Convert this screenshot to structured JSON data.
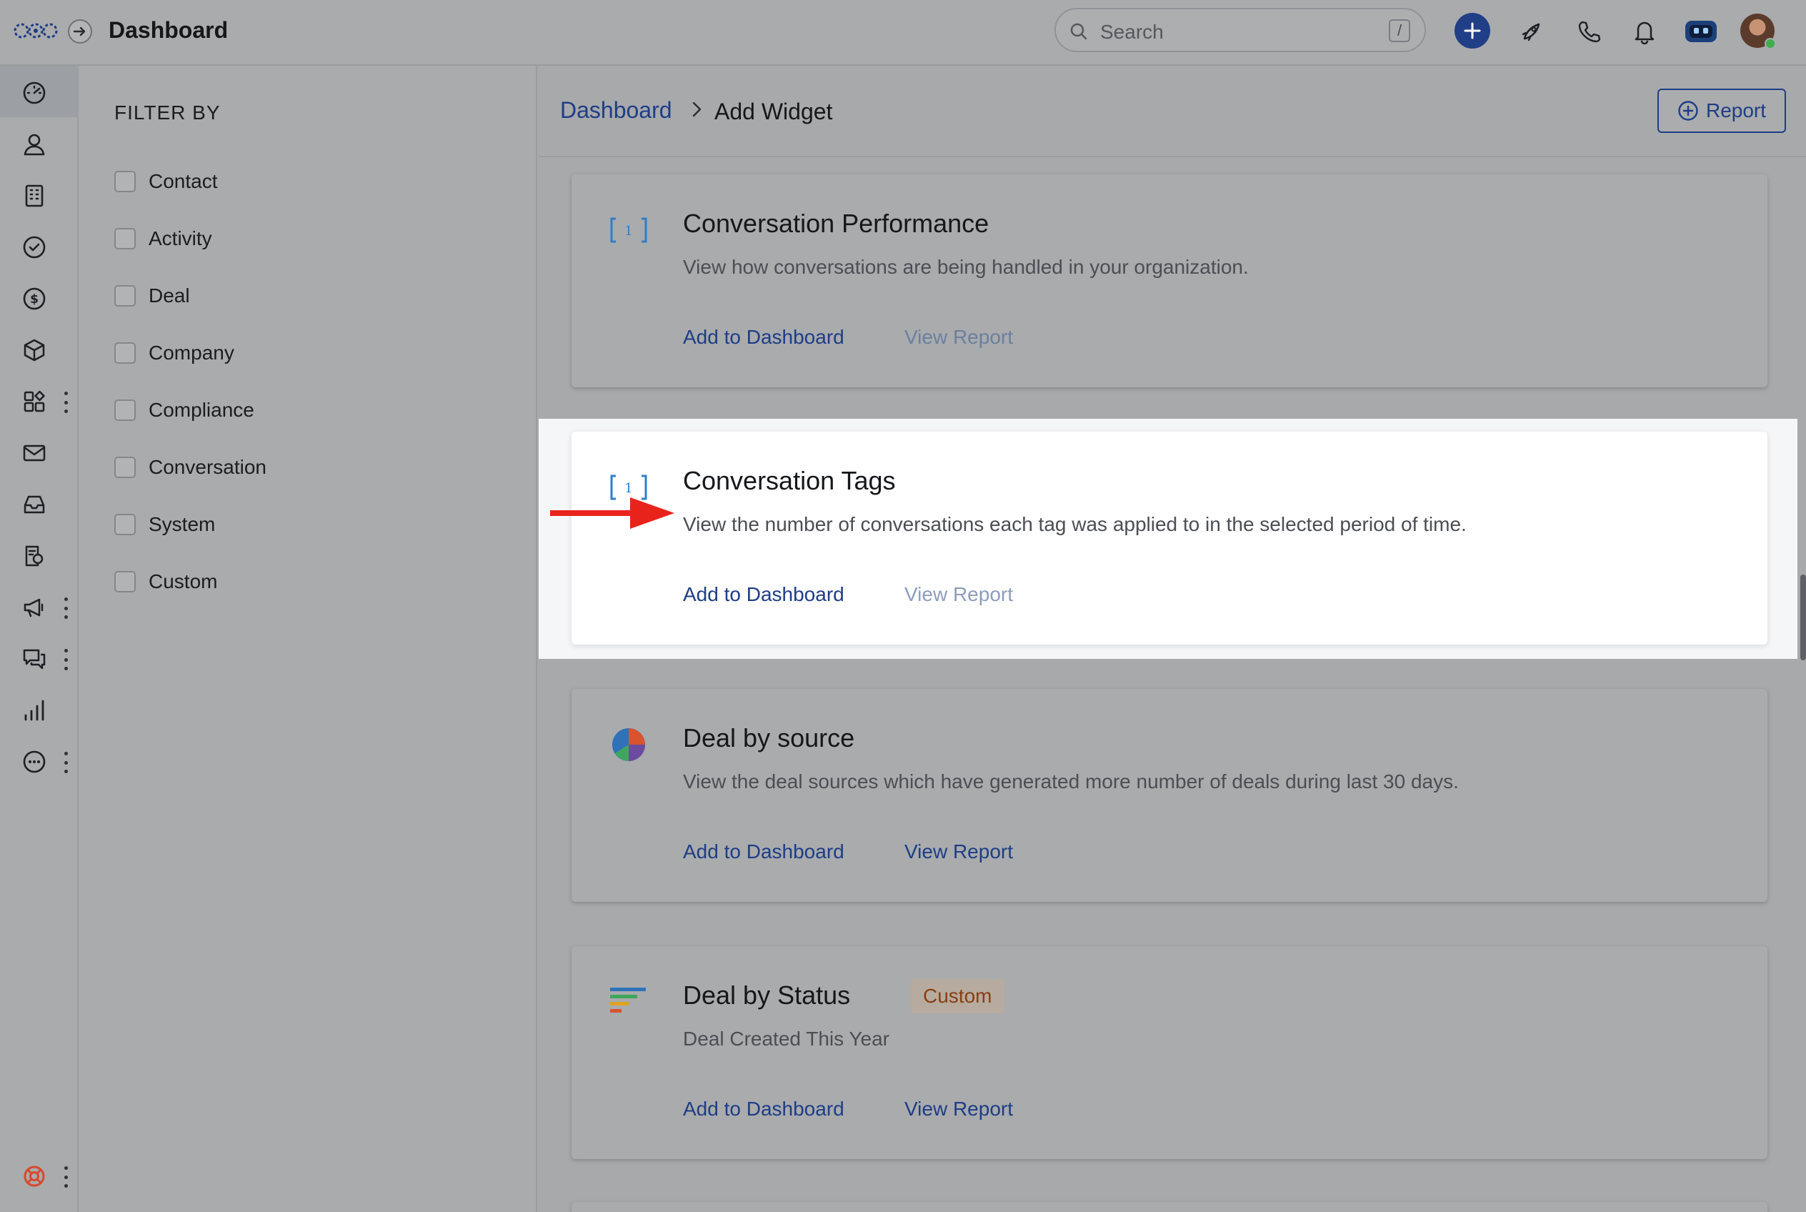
{
  "header": {
    "title": "Dashboard",
    "search_placeholder": "Search",
    "search_shortcut": "/",
    "icons": [
      "add-icon",
      "rocket-icon",
      "phone-icon",
      "bell-icon",
      "bot-icon",
      "user-avatar"
    ]
  },
  "rail": {
    "icons": [
      "dashboard-icon",
      "contacts-icon",
      "companies-icon",
      "tasks-icon",
      "deals-icon",
      "products-icon",
      "apps-icon",
      "email-icon",
      "inbox-icon",
      "documents-icon",
      "campaigns-icon",
      "conversations-icon",
      "reports-icon",
      "more-icon",
      "help-icon"
    ]
  },
  "filter": {
    "title": "FILTER BY",
    "items": [
      "Contact",
      "Activity",
      "Deal",
      "Company",
      "Compliance",
      "Conversation",
      "System",
      "Custom"
    ]
  },
  "breadcrumb": {
    "link": "Dashboard",
    "current": "Add Widget"
  },
  "report_button": "Report",
  "widgets": [
    {
      "title": "Conversation Performance",
      "description": "View how conversations are being handled in your organization.",
      "add_label": "Add to Dashboard",
      "view_label": "View Report",
      "icon": "bracket-number-icon"
    },
    {
      "title": "Conversation Tags",
      "description": "View the number of conversations each tag was applied to in the selected period of time.",
      "add_label": "Add to Dashboard",
      "view_label": "View Report",
      "icon": "bracket-number-icon"
    },
    {
      "title": "Deal by source",
      "description": "View the deal sources which have generated more number of deals during last 30 days.",
      "add_label": "Add to Dashboard",
      "view_label": "View Report",
      "icon": "pie-chart-icon"
    },
    {
      "title": "Deal by Status",
      "badge": "Custom",
      "description": "Deal Created This Year",
      "add_label": "Add to Dashboard",
      "view_label": "View Report",
      "icon": "funnel-bars-icon"
    }
  ],
  "colors": {
    "accent": "#1e3d86",
    "arrow": "#e8231c",
    "badge_text": "#8a3e12"
  }
}
